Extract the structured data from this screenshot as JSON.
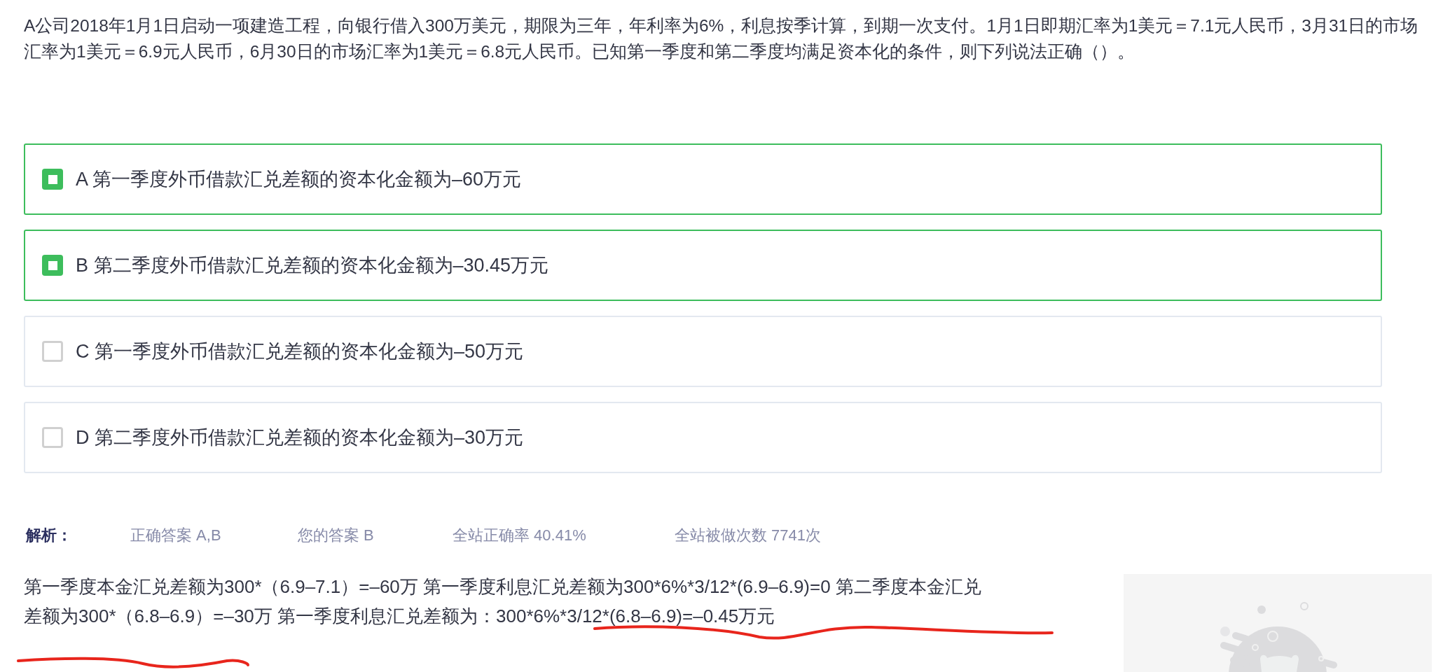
{
  "question": "A公司2018年1月1日启动一项建造工程，向银行借入300万美元，期限为三年，年利率为6%，利息按季计算，到期一次支付。1月1日即期汇率为1美元＝7.1元人民币，3月31日的市场汇率为1美元＝6.9元人民币，6月30日的市场汇率为1美元＝6.8元人民币。已知第一季度和第二季度均满足资本化的条件，则下列说法正确（）。",
  "options": [
    {
      "letter": "A",
      "text": "第一季度外币借款汇兑差额的资本化金额为–60万元",
      "selected": true
    },
    {
      "letter": "B",
      "text": "第二季度外币借款汇兑差额的资本化金额为–30.45万元",
      "selected": true
    },
    {
      "letter": "C",
      "text": "第一季度外币借款汇兑差额的资本化金额为–50万元",
      "selected": false
    },
    {
      "letter": "D",
      "text": "第二季度外币借款汇兑差额的资本化金额为–30万元",
      "selected": false
    }
  ],
  "analysis": {
    "label": "解析：",
    "stats": [
      "正确答案 A,B",
      "您的答案 B",
      "全站正确率 40.41%",
      "全站被做次数 7741次"
    ]
  },
  "explanation": "第一季度本金汇兑差额为300*（6.9–7.1）=–60万 第一季度利息汇兑差额为300*6%*3/12*(6.9–6.9)=0 第二季度本金汇兑差额为300*（6.8–6.9）=–30万 第一季度利息汇兑差额为：300*6%*3/12*(6.8–6.9)=–0.45万元"
}
